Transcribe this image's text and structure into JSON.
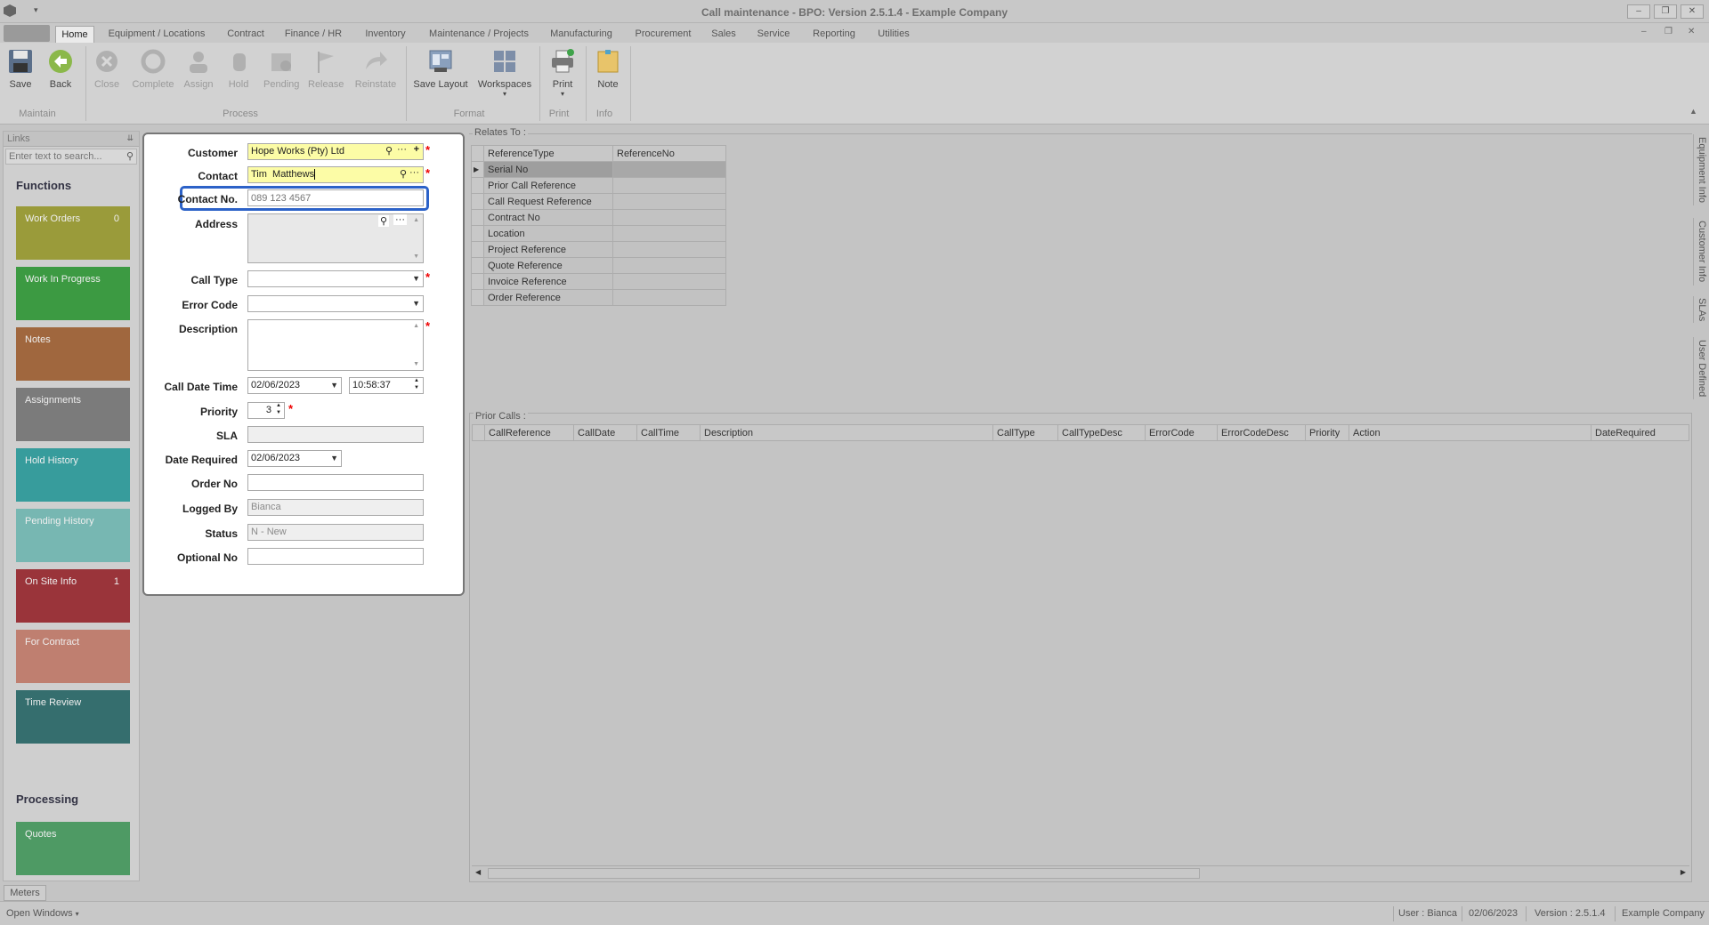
{
  "window": {
    "title": "Call maintenance - BPO: Version 2.5.1.4 - Example Company"
  },
  "tabs": [
    "Home",
    "Equipment / Locations",
    "Contract",
    "Finance / HR",
    "Inventory",
    "Maintenance / Projects",
    "Manufacturing",
    "Procurement",
    "Sales",
    "Service",
    "Reporting",
    "Utilities"
  ],
  "ribbon": {
    "buttons": {
      "save": "Save",
      "back": "Back",
      "close": "Close",
      "complete": "Complete",
      "assign": "Assign",
      "hold": "Hold",
      "pending": "Pending",
      "release": "Release",
      "reinstate": "Reinstate",
      "save_layout": "Save Layout",
      "workspaces": "Workspaces",
      "print": "Print",
      "note": "Note"
    },
    "groups": {
      "maintain": "Maintain",
      "process": "Process",
      "format": "Format",
      "print": "Print",
      "info": "Info"
    }
  },
  "links": {
    "title": "Links",
    "search_placeholder": "Enter text to search...",
    "functions_heading": "Functions",
    "processing_heading": "Processing",
    "tiles": [
      {
        "label": "Work Orders",
        "count": "0",
        "color": "#9a9b3a"
      },
      {
        "label": "Work In Progress",
        "count": "",
        "color": "#3c9a42"
      },
      {
        "label": "Notes",
        "count": "",
        "color": "#a0673e"
      },
      {
        "label": "Assignments",
        "count": "",
        "color": "#7b7b7b"
      },
      {
        "label": "Hold History",
        "count": "",
        "color": "#379c9c"
      },
      {
        "label": "Pending History",
        "count": "",
        "color": "#77b7b2"
      },
      {
        "label": "On Site Info",
        "count": "1",
        "color": "#9a343a"
      },
      {
        "label": "For Contract",
        "count": "",
        "color": "#bf7f70"
      },
      {
        "label": "Time Review",
        "count": "",
        "color": "#356e6e"
      }
    ],
    "processing_tiles": [
      {
        "label": "Quotes",
        "color": "#4e9a64"
      }
    ]
  },
  "form": {
    "customer": {
      "label": "Customer",
      "value": "Hope Works (Pty) Ltd"
    },
    "contact": {
      "label": "Contact",
      "value": "Tim  Matthews"
    },
    "contact_no": {
      "label": "Contact No.",
      "placeholder": "089 123 4567"
    },
    "address": {
      "label": "Address",
      "value": ""
    },
    "call_type": {
      "label": "Call Type",
      "value": ""
    },
    "error_code": {
      "label": "Error Code",
      "value": ""
    },
    "description": {
      "label": "Description",
      "value": ""
    },
    "call_date_time": {
      "label": "Call Date Time",
      "date": "02/06/2023",
      "time": "10:58:37"
    },
    "priority": {
      "label": "Priority",
      "value": "3"
    },
    "sla": {
      "label": "SLA",
      "value": ""
    },
    "date_required": {
      "label": "Date Required",
      "value": "02/06/2023"
    },
    "order_no": {
      "label": "Order No",
      "value": ""
    },
    "logged_by": {
      "label": "Logged By",
      "value": "Bianca"
    },
    "status": {
      "label": "Status",
      "value": "N - New"
    },
    "optional_no": {
      "label": "Optional No",
      "value": ""
    }
  },
  "relates_to": {
    "title": "Relates To :",
    "columns": [
      "ReferenceType",
      "ReferenceNo"
    ],
    "rows": [
      "Serial No",
      "Prior Call Reference",
      "Call Request Reference",
      "Contract No",
      "Location",
      "Project Reference",
      "Quote Reference",
      "Invoice Reference",
      "Order Reference"
    ]
  },
  "prior_calls": {
    "title": "Prior Calls :",
    "columns": [
      "CallReference",
      "CallDate",
      "CallTime",
      "Description",
      "CallType",
      "CallTypeDesc",
      "ErrorCode",
      "ErrorCodeDesc",
      "Priority",
      "Action",
      "DateRequired"
    ]
  },
  "right_tabs": [
    "Equipment Info",
    "Customer Info",
    "SLAs",
    "User Defined"
  ],
  "bottom_tab": "Meters",
  "status_bar": {
    "open_windows": "Open Windows",
    "user": "User : Bianca",
    "date": "02/06/2023",
    "version": "Version : 2.5.1.4",
    "company": "Example Company"
  }
}
